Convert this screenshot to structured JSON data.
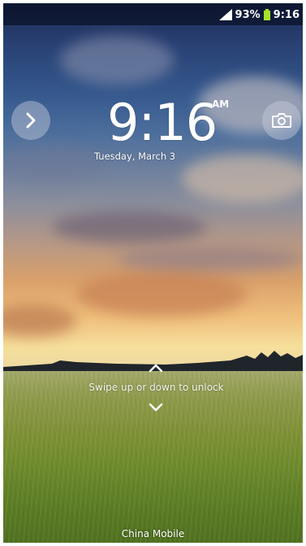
{
  "status_bar": {
    "battery_percent": "93%",
    "time": "9:16",
    "icons": [
      "signal-icon",
      "battery-icon"
    ],
    "battery_color": "#a6e22e"
  },
  "lockscreen": {
    "time": "9:16",
    "ampm": "AM",
    "date": "Tuesday, March 3",
    "left_button_icon": "chevron-right-icon",
    "right_button_icon": "camera-icon",
    "unlock_hint": "Swipe up or down to unlock",
    "unlock_icons": [
      "chevron-up-icon",
      "chevron-down-icon"
    ],
    "carrier": "China Mobile"
  }
}
